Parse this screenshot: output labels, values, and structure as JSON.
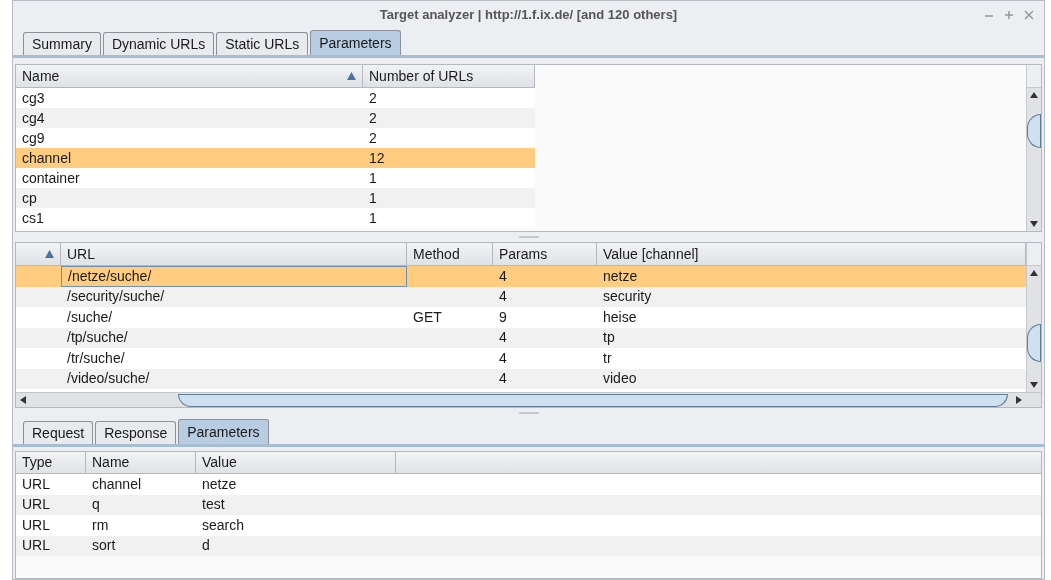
{
  "window": {
    "title": "Target analyzer | http://1.f.ix.de/ [and 120 others]"
  },
  "tabs": [
    {
      "label": "Summary",
      "selected": false
    },
    {
      "label": "Dynamic URLs",
      "selected": false
    },
    {
      "label": "Static URLs",
      "selected": false
    },
    {
      "label": "Parameters",
      "selected": true
    }
  ],
  "parameters_table": {
    "columns": [
      "Name",
      "Number of URLs"
    ],
    "rows": [
      {
        "cells": [
          "cg3",
          "2"
        ],
        "selected": false
      },
      {
        "cells": [
          "cg4",
          "2"
        ],
        "selected": false
      },
      {
        "cells": [
          "cg9",
          "2"
        ],
        "selected": false
      },
      {
        "cells": [
          "channel",
          "12"
        ],
        "selected": true
      },
      {
        "cells": [
          "container",
          "1"
        ],
        "selected": false
      },
      {
        "cells": [
          "cp",
          "1"
        ],
        "selected": false
      },
      {
        "cells": [
          "cs1",
          "1"
        ],
        "selected": false
      }
    ]
  },
  "urls_table": {
    "columns": [
      "URL",
      "Method",
      "Params",
      "Value [channel]"
    ],
    "rows": [
      {
        "cells": [
          "/netze/suche/",
          "",
          "4",
          "netze"
        ],
        "selected": true
      },
      {
        "cells": [
          "/security/suche/",
          "",
          "4",
          "security"
        ],
        "selected": false
      },
      {
        "cells": [
          "/suche/",
          "GET",
          "9",
          "heise"
        ],
        "selected": false
      },
      {
        "cells": [
          "/tp/suche/",
          "",
          "4",
          "tp"
        ],
        "selected": false
      },
      {
        "cells": [
          "/tr/suche/",
          "",
          "4",
          "tr"
        ],
        "selected": false
      },
      {
        "cells": [
          "/video/suche/",
          "",
          "4",
          "video"
        ],
        "selected": false
      }
    ]
  },
  "detail_tabs": [
    {
      "label": "Request",
      "selected": false
    },
    {
      "label": "Response",
      "selected": false
    },
    {
      "label": "Parameters",
      "selected": true
    }
  ],
  "detail_table": {
    "columns": [
      "Type",
      "Name",
      "Value"
    ],
    "rows": [
      [
        "URL",
        "channel",
        "netze"
      ],
      [
        "URL",
        "q",
        "test"
      ],
      [
        "URL",
        "rm",
        "search"
      ],
      [
        "URL",
        "sort",
        "d"
      ]
    ]
  }
}
